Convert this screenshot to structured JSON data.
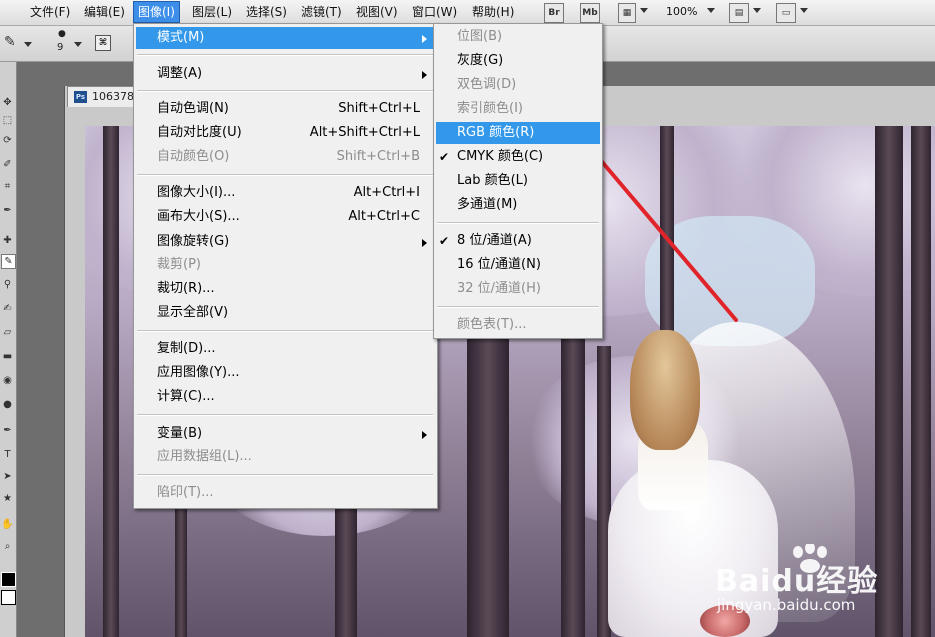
{
  "menubar": {
    "items": [
      "文件(F)",
      "编辑(E)",
      "图像(I)",
      "图层(L)",
      "选择(S)",
      "滤镜(T)",
      "视图(V)",
      "窗口(W)",
      "帮助(H)"
    ],
    "bridge_btn": "Br",
    "minibridge_btn": "Mb",
    "zoom": "100%"
  },
  "optbar": {
    "brush_size": "9"
  },
  "document": {
    "title": "106378"
  },
  "image_menu": {
    "items": [
      {
        "label": "模式(M)",
        "shortcut": "",
        "submenu": true,
        "state": "highlight"
      },
      {
        "label": "调整(A)",
        "shortcut": "",
        "submenu": true,
        "state": "enabled"
      },
      {
        "label": "自动色调(N)",
        "shortcut": "Shift+Ctrl+L",
        "state": "enabled"
      },
      {
        "label": "自动对比度(U)",
        "shortcut": "Alt+Shift+Ctrl+L",
        "state": "enabled"
      },
      {
        "label": "自动颜色(O)",
        "shortcut": "Shift+Ctrl+B",
        "state": "disabled"
      },
      {
        "label": "图像大小(I)...",
        "shortcut": "Alt+Ctrl+I",
        "state": "enabled"
      },
      {
        "label": "画布大小(S)...",
        "shortcut": "Alt+Ctrl+C",
        "state": "enabled"
      },
      {
        "label": "图像旋转(G)",
        "shortcut": "",
        "submenu": true,
        "state": "enabled"
      },
      {
        "label": "裁剪(P)",
        "shortcut": "",
        "state": "disabled"
      },
      {
        "label": "裁切(R)...",
        "shortcut": "",
        "state": "enabled"
      },
      {
        "label": "显示全部(V)",
        "shortcut": "",
        "state": "enabled"
      },
      {
        "label": "复制(D)...",
        "shortcut": "",
        "state": "enabled"
      },
      {
        "label": "应用图像(Y)...",
        "shortcut": "",
        "state": "enabled"
      },
      {
        "label": "计算(C)...",
        "shortcut": "",
        "state": "enabled"
      },
      {
        "label": "变量(B)",
        "shortcut": "",
        "submenu": true,
        "state": "enabled"
      },
      {
        "label": "应用数据组(L)...",
        "shortcut": "",
        "state": "disabled"
      },
      {
        "label": "陷印(T)...",
        "shortcut": "",
        "state": "disabled"
      }
    ]
  },
  "mode_menu": {
    "items": [
      {
        "label": "位图(B)",
        "state": "disabled",
        "checked": false
      },
      {
        "label": "灰度(G)",
        "state": "enabled",
        "checked": false
      },
      {
        "label": "双色调(D)",
        "state": "disabled",
        "checked": false
      },
      {
        "label": "索引颜色(I)",
        "state": "disabled",
        "checked": false
      },
      {
        "label": "RGB 颜色(R)",
        "state": "highlight",
        "checked": false
      },
      {
        "label": "CMYK 颜色(C)",
        "state": "enabled",
        "checked": true
      },
      {
        "label": "Lab 颜色(L)",
        "state": "enabled",
        "checked": false
      },
      {
        "label": "多通道(M)",
        "state": "enabled",
        "checked": false
      },
      {
        "label": "8 位/通道(A)",
        "state": "enabled",
        "checked": true
      },
      {
        "label": "16 位/通道(N)",
        "state": "enabled",
        "checked": false
      },
      {
        "label": "32 位/通道(H)",
        "state": "disabled",
        "checked": false
      },
      {
        "label": "颜色表(T)...",
        "state": "disabled",
        "checked": false
      }
    ]
  },
  "checkmark": "✔",
  "watermark": {
    "brand": "Baidu经验",
    "url": "jingyan.baidu.com"
  },
  "colors": {
    "menu_highlight": "#3398ea",
    "annotation_arrow": "#e0242a"
  }
}
